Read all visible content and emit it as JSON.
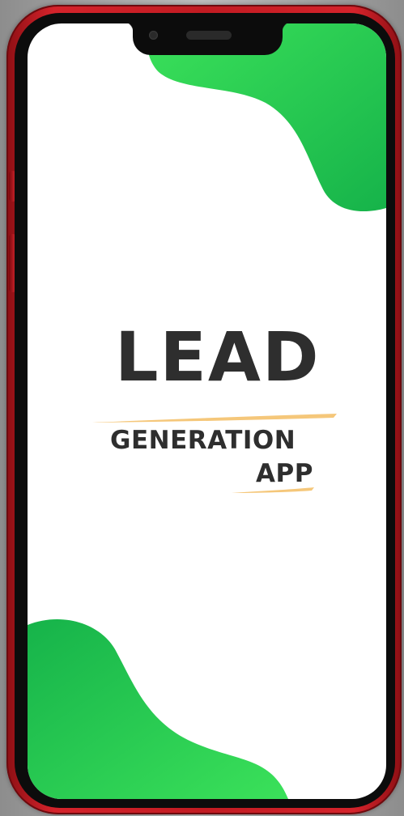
{
  "logo": {
    "line1": "LEAD",
    "line2": "GENERATION",
    "line3": "APP"
  },
  "colors": {
    "text": "#2e2e2e",
    "accent_underline": "#f5c77a",
    "blob_green_light": "#3be15a",
    "blob_green_dark": "#16b34a",
    "phone_frame": "#c21b22",
    "screen_background": "#ffffff"
  }
}
